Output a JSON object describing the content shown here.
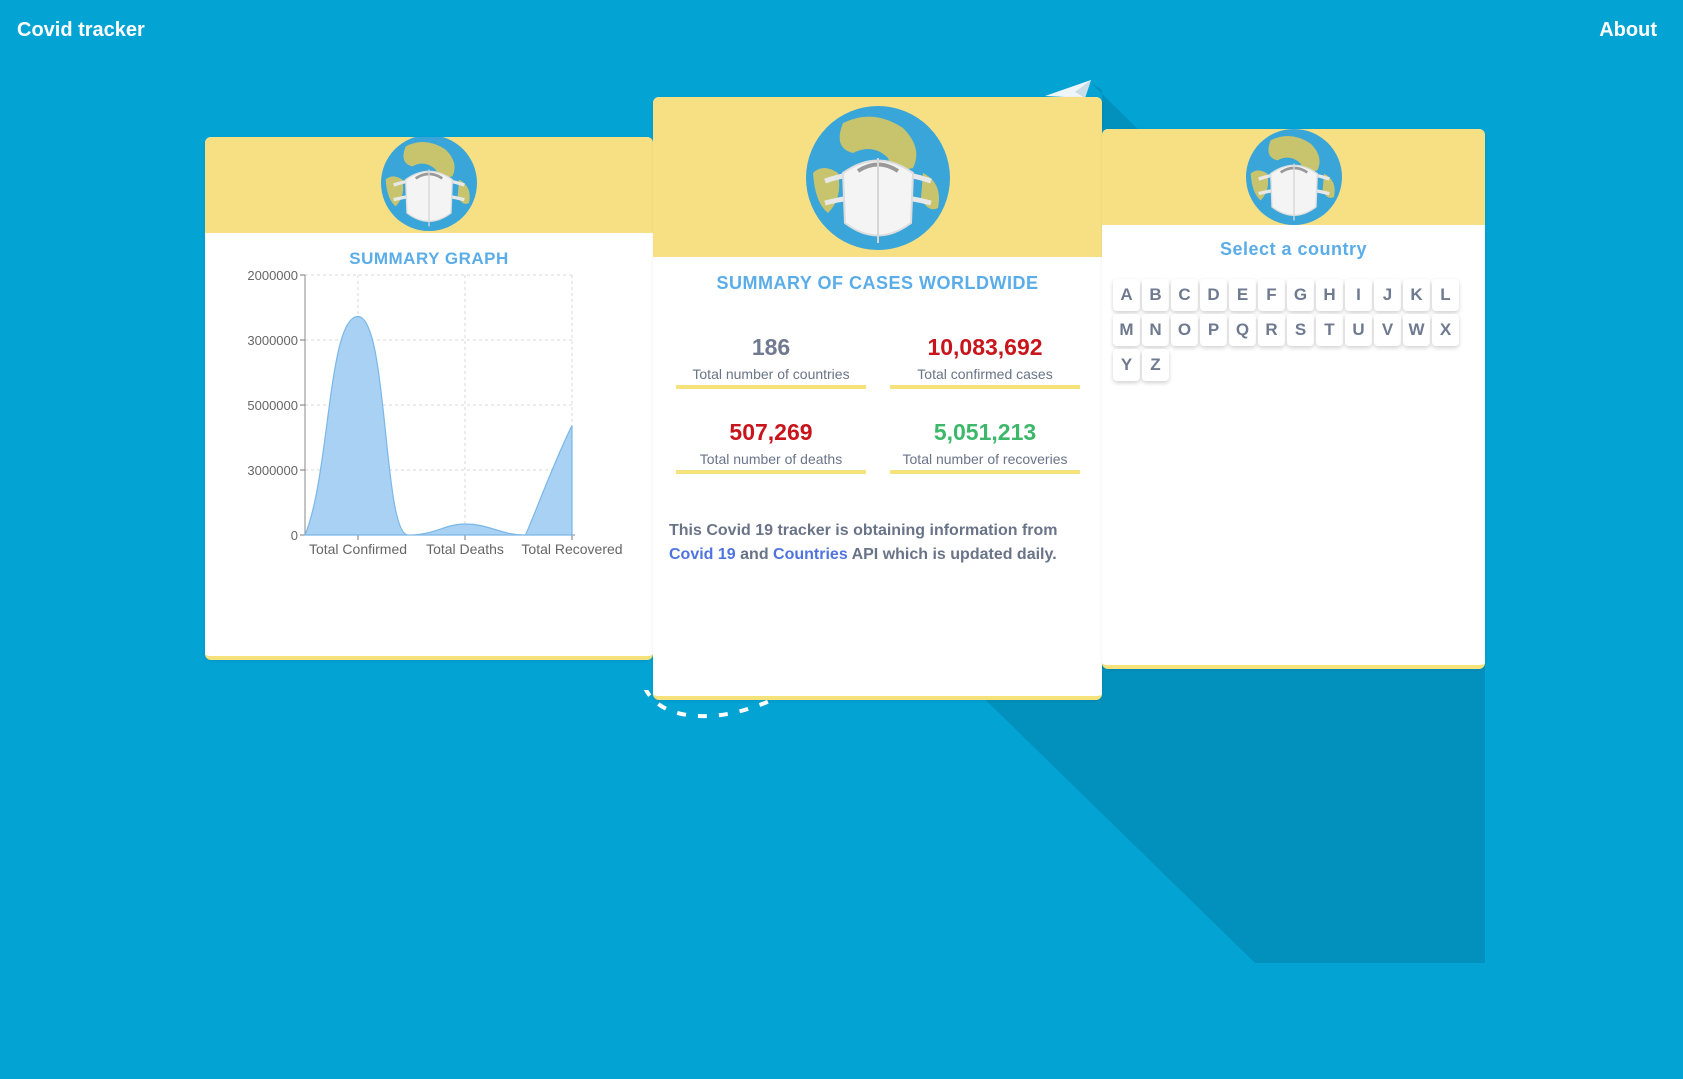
{
  "colors": {
    "background": "#03a3d4",
    "card_header": "#f7e084",
    "title": "#5aade8",
    "red": "#c8151c",
    "green": "#3db86a"
  },
  "nav": {
    "brand": "Covid tracker",
    "about": "About"
  },
  "graph_card": {
    "title": "SUMMARY GRAPH"
  },
  "chart_data": {
    "type": "area",
    "categories": [
      "Total Confirmed",
      "Total Deaths",
      "Total Recovered"
    ],
    "values": [
      10083692,
      507269,
      5051213
    ],
    "ytick_labels": [
      "0",
      "3000000",
      "5000000",
      "3000000",
      "2000000"
    ],
    "ylim": [
      0,
      12000000
    ],
    "grid": true
  },
  "summary_card": {
    "title": "SUMMARY OF CASES WORLDWIDE",
    "stats": [
      {
        "value": "186",
        "label": "Total number of countries"
      },
      {
        "value": "10,083,692",
        "label": "Total confirmed cases"
      },
      {
        "value": "507,269",
        "label": "Total number of deaths"
      },
      {
        "value": "5,051,213",
        "label": "Total number of recoveries"
      }
    ],
    "info": {
      "text_before": "This Covid 19 tracker is obtaining information from",
      "link1": "Covid 19",
      "and": "and",
      "link2": "Countries",
      "text_after": "API which is updated daily."
    }
  },
  "country_card": {
    "title": "Select a country",
    "letters": [
      "A",
      "B",
      "C",
      "D",
      "E",
      "F",
      "G",
      "H",
      "I",
      "J",
      "K",
      "L",
      "M",
      "N",
      "O",
      "P",
      "Q",
      "R",
      "S",
      "T",
      "U",
      "V",
      "W",
      "X",
      "Y",
      "Z"
    ]
  }
}
